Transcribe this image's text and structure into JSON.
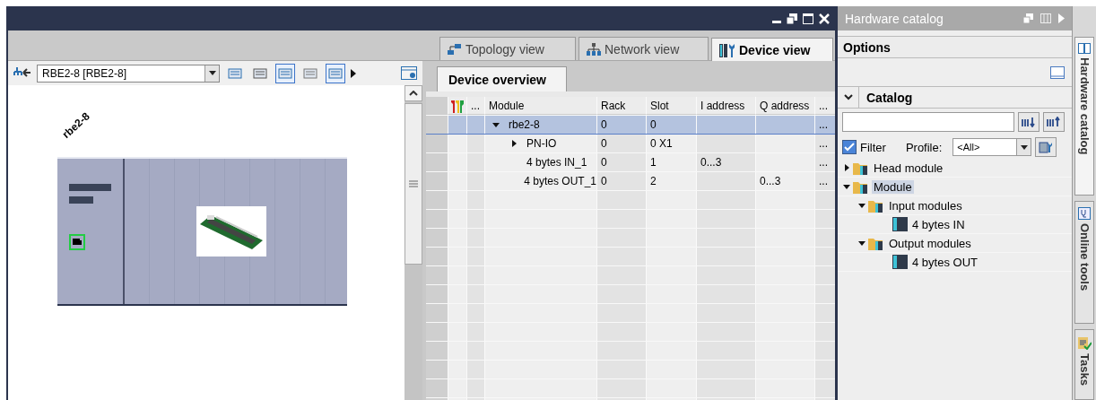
{
  "view_tabs": [
    {
      "label": "Topology view",
      "kind": "topology",
      "selected": false
    },
    {
      "label": "Network view",
      "kind": "network",
      "selected": false
    },
    {
      "label": "Device view",
      "kind": "device",
      "selected": true
    }
  ],
  "device_selector": {
    "value": "RBE2-8 [RBE2-8]"
  },
  "canvas": {
    "device_label": "rbe2-8"
  },
  "overview": {
    "tab": "Device overview",
    "columns": [
      "...",
      "Module",
      "Rack",
      "Slot",
      "I address",
      "Q address",
      "..."
    ],
    "rows": [
      {
        "module": "rbe2-8",
        "rack": "0",
        "slot": "0",
        "more": "...",
        "selected": true,
        "expanded": true,
        "children": [
          {
            "module": "PN-IO",
            "rack": "0",
            "slot": "0 X1",
            "more": "...",
            "selected": false,
            "expanded": false
          },
          {
            "module": "4 bytes IN_1",
            "rack": "0",
            "slot": "1",
            "i_address": "0...3",
            "more": "...",
            "selected": false
          },
          {
            "module": "4 bytes OUT_1",
            "rack": "0",
            "slot": "2",
            "q_address": "0...3",
            "more": "...",
            "selected": false
          }
        ]
      }
    ]
  },
  "catalog": {
    "title": "Hardware catalog",
    "options": "Options",
    "section": "Catalog",
    "section_expanded": true,
    "filter": {
      "label": "Filter",
      "checked": true
    },
    "profile": {
      "label": "Profile:",
      "value": "<All>"
    },
    "tree": [
      {
        "label": "Head module",
        "kind": "folder",
        "expanded": false,
        "selected": false
      },
      {
        "label": "Module",
        "kind": "folder",
        "expanded": true,
        "selected": true,
        "children": [
          {
            "label": "Input modules",
            "kind": "folder",
            "expanded": true,
            "selected": false,
            "children": [
              {
                "label": "4 bytes IN",
                "kind": "module",
                "selected": false
              }
            ]
          },
          {
            "label": "Output modules",
            "kind": "folder",
            "expanded": true,
            "selected": false,
            "children": [
              {
                "label": "4 bytes OUT",
                "kind": "module",
                "selected": false
              }
            ]
          }
        ]
      }
    ]
  },
  "side_tabs": [
    {
      "label": "Hardware catalog",
      "kind": "catalog",
      "selected": true
    },
    {
      "label": "Online tools",
      "kind": "online",
      "selected": false
    },
    {
      "label": "Tasks",
      "kind": "tasks",
      "selected": false
    }
  ]
}
